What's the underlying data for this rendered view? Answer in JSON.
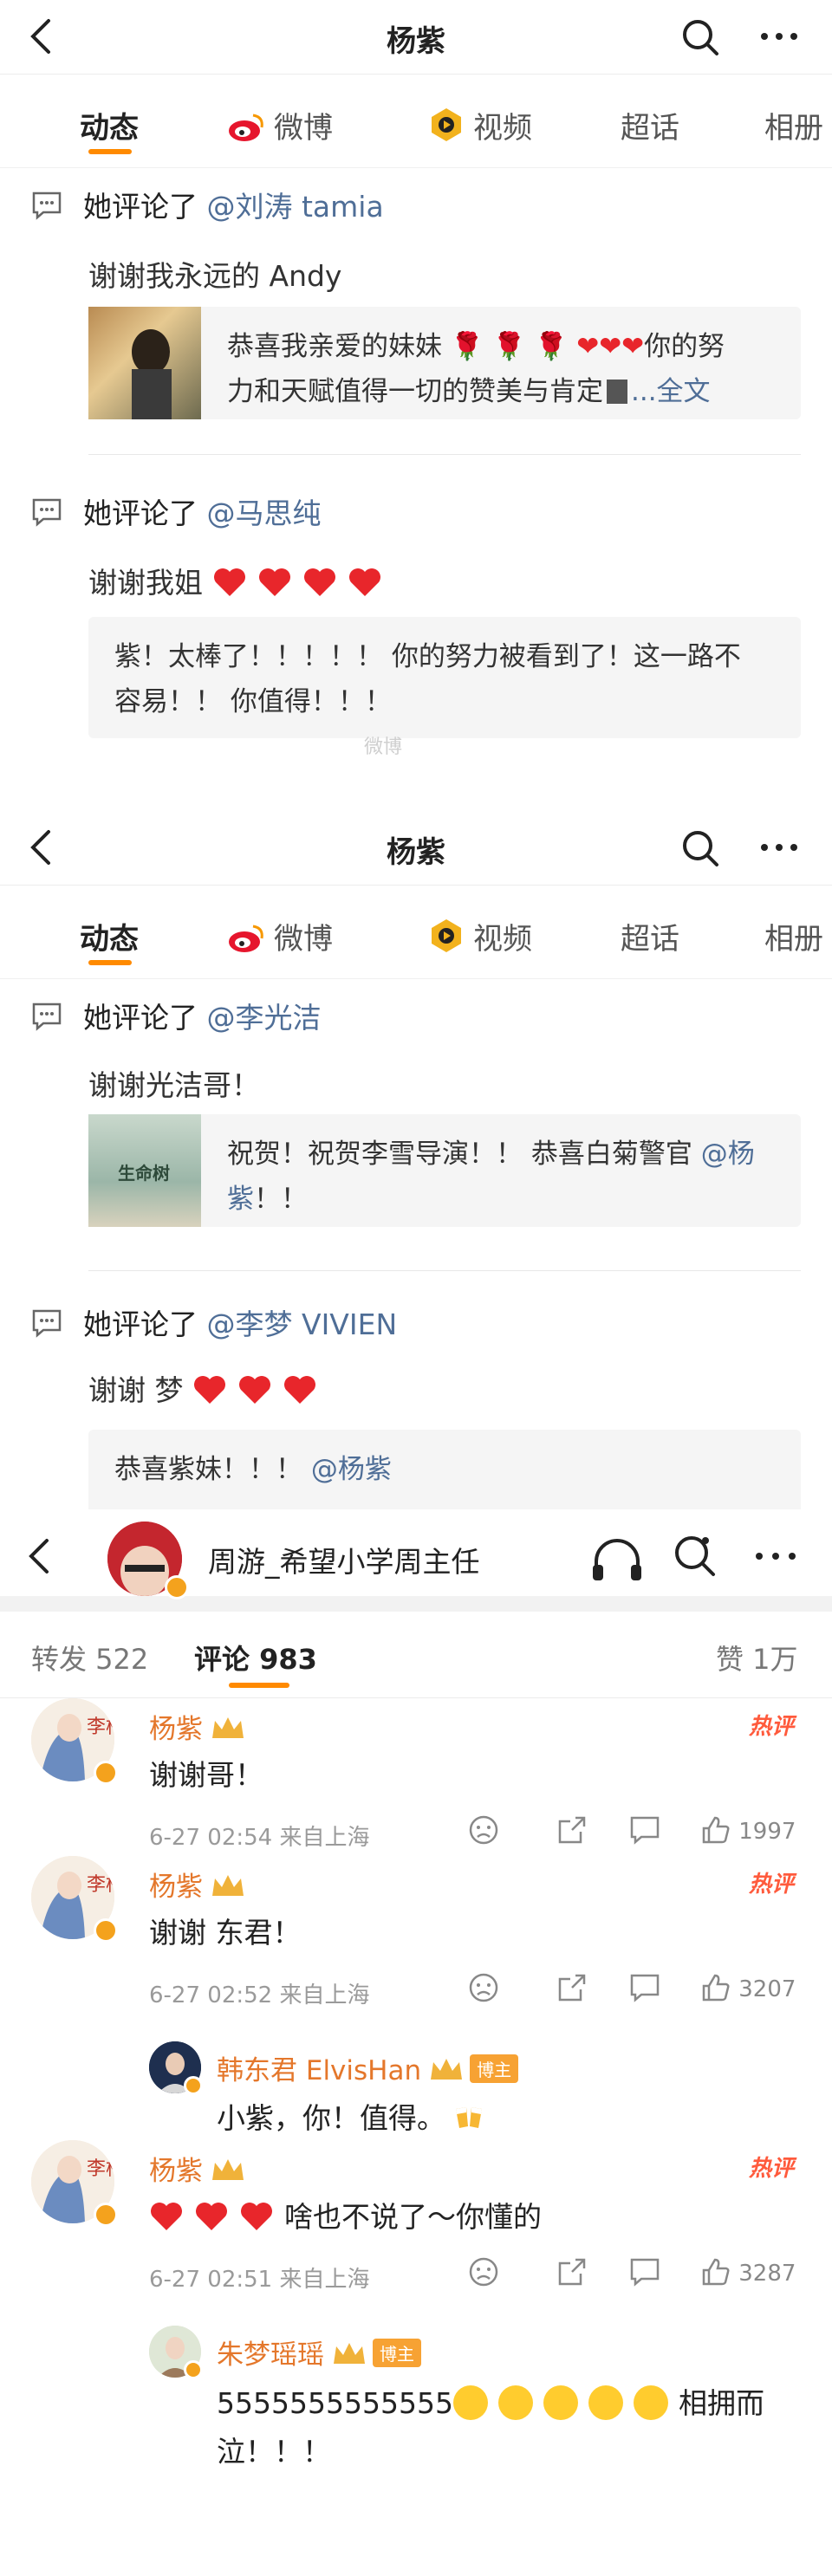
{
  "header": {
    "title": "杨紫"
  },
  "tabs": [
    {
      "label": "动态"
    },
    {
      "label": "微博"
    },
    {
      "label": "视频"
    },
    {
      "label": "超话"
    },
    {
      "label": "相册"
    }
  ],
  "section1": {
    "items": [
      {
        "prefix": "她评论了",
        "mention": "@刘涛 tamia",
        "reply": "谢谢我永远的 Andy",
        "quote_line1": "恭喜我亲爱的妹妹",
        "quote_line1_end": "你的努",
        "quote_line2": "力和天赋值得一切的赞美与肯定",
        "quote_more": "...全文"
      },
      {
        "prefix": "她评论了",
        "mention": "@马思纯",
        "reply": "谢谢我姐",
        "quote_line1": "紫！太棒了！！！！！ 你的努力被看到了！这一路不",
        "quote_line2": "容易！！ 你值得！！！"
      }
    ]
  },
  "section2": {
    "items": [
      {
        "prefix": "她评论了",
        "mention": "@李光洁",
        "reply": "谢谢光洁哥！",
        "quote_line1": "祝贺！祝贺李雪导演！！ 恭喜白菊警官",
        "quote_line1_link": "@杨",
        "quote_line2_link": "紫",
        "quote_line2": "！！",
        "thumb_label": "生命树"
      },
      {
        "prefix": "她评论了",
        "mention": "@李梦 VIVIEN",
        "reply": "谢谢 梦",
        "quote_line1": "恭喜紫妹！！！",
        "quote_line1_link": "@杨紫"
      }
    ]
  },
  "watermark": "微博",
  "post": {
    "author": "周游_希望小学周主任",
    "tabs": {
      "repost": "转发 522",
      "comment": "评论 983",
      "like": "赞 1万"
    },
    "comments": [
      {
        "name": "杨紫",
        "text": "谢谢哥！",
        "meta": "6-27 02:54  来自上海",
        "likes": "1997",
        "hot": "热评",
        "avatar_text": "李柏"
      },
      {
        "name": "杨紫",
        "text": "谢谢 东君！",
        "meta": "6-27 02:52  来自上海",
        "likes": "3207",
        "hot": "热评",
        "avatar_text": "李柏",
        "sub": {
          "name": "韩东君 ElvisHan",
          "badge": "博主",
          "text": "小紫，你！值得。"
        }
      },
      {
        "name": "杨紫",
        "text": "啥也不说了～你懂的",
        "meta": "6-27 02:51  来自上海",
        "likes": "3287",
        "hot": "热评",
        "avatar_text": "李柏",
        "sub": {
          "name": "朱梦瑶瑶",
          "badge": "博主",
          "text_start": "5555555555555",
          "text_end": "相拥而",
          "text_line2": "泣！！！"
        }
      }
    ]
  },
  "colors": {
    "accent": "#ff8a00",
    "link": "#4f6e97",
    "name": "#e4772b",
    "hot": "#ff5a3c",
    "heart": "#e8262b"
  }
}
